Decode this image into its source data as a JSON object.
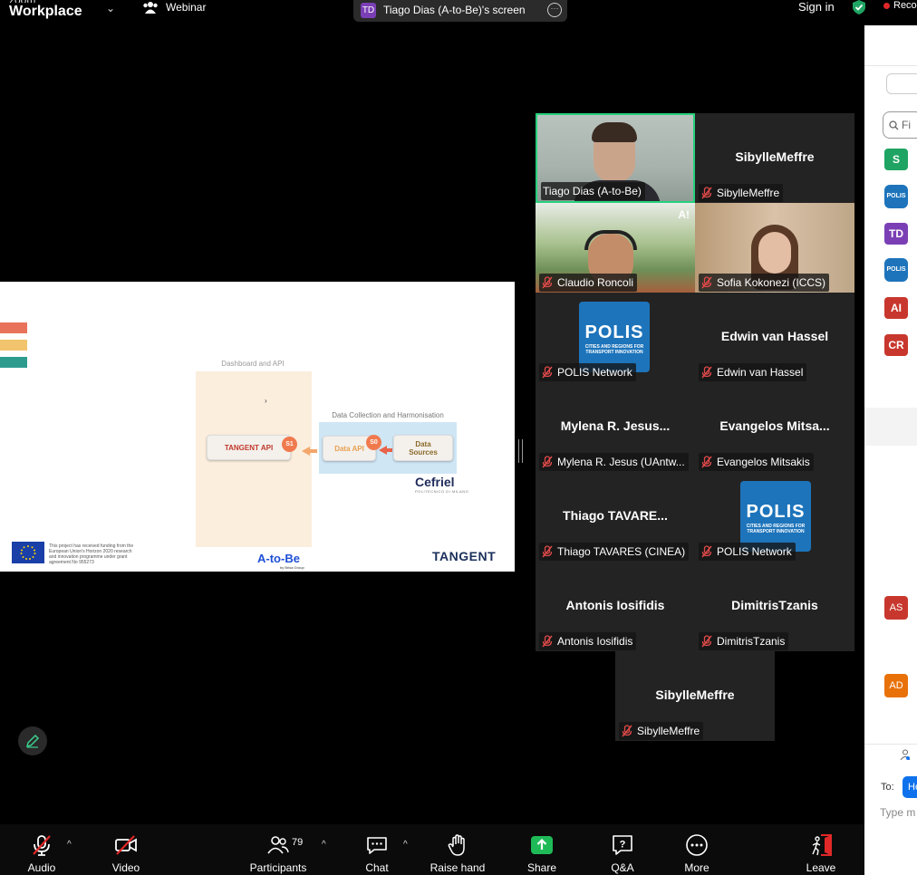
{
  "topbar": {
    "brand_top": "zoom",
    "brand_name": "Workplace",
    "webinar_label": "Webinar",
    "share_badge": "TD",
    "share_title": "Tiago Dias (A-to-Be)'s screen",
    "sign_in": "Sign in",
    "recording": "Reco"
  },
  "slide": {
    "dashboard_title": "Dashboard and API",
    "collection_title": "Data Collection and Harmonisation",
    "tangent_api": "TANGENT API",
    "data_api": "Data API",
    "data_sources": "Data Sources",
    "step_s1": "S1",
    "step_s0": "S0",
    "cefriel": "Cefriel",
    "cefriel_sub": "POLITECNICO DI MILANO",
    "eu_text": "This project has received funding from the European Union's Horizon 2020 research and innovation programme under grant agreement No 955273",
    "atobe": "A-to-Be",
    "atobe_sub": "by Brisa Group",
    "tangent": "TANGENT",
    "colors": {
      "bar1": "#e8735a",
      "bar2": "#f2c46d",
      "bar3": "#2e9b8f"
    }
  },
  "gallery": [
    {
      "display_name": "",
      "label": "Tiago Dias (A-to-Be)",
      "muted": false,
      "video": true
    },
    {
      "display_name": "SibylleMeffre",
      "label": "SibylleMeffre",
      "muted": true
    },
    {
      "display_name": "",
      "label": "Claudio Roncoli",
      "muted": true,
      "video": true,
      "flag": "A!"
    },
    {
      "display_name": "",
      "label": "Sofia Kokonezi (ICCS)",
      "muted": true,
      "video": true
    },
    {
      "display_name": "",
      "label": "POLIS Network",
      "muted": true,
      "polis": true
    },
    {
      "display_name": "Edwin van Hassel",
      "label": "Edwin van Hassel",
      "muted": true
    },
    {
      "display_name": "Mylena R. Jesus...",
      "label": "Mylena R. Jesus (UAntw...",
      "muted": true
    },
    {
      "display_name": "Evangelos  Mitsa...",
      "label": "Evangelos Mitsakis",
      "muted": true
    },
    {
      "display_name": "Thiago  TAVARE...",
      "label": "Thiago TAVARES (CINEA)",
      "muted": true
    },
    {
      "display_name": "",
      "label": "POLIS Network",
      "muted": true,
      "polis": true
    },
    {
      "display_name": "Antonis Iosifidis",
      "label": "Antonis Iosifidis",
      "muted": true
    },
    {
      "display_name": "DimitrisTzanis",
      "label": "DimitrisTzanis",
      "muted": true
    },
    {
      "display_name": "SibylleMeffre",
      "label": "SibylleMeffre",
      "muted": true
    }
  ],
  "polis_logo": {
    "title": "POLIS",
    "subtitle": "CITIES AND REGIONS FOR TRANSPORT INNOVATION"
  },
  "right_panel": {
    "search_placeholder": "Fi",
    "avatars": [
      {
        "initials": "S",
        "color": "#1fa463"
      },
      {
        "initials": "POLIS",
        "color": "#1d74bb"
      },
      {
        "initials": "TD",
        "color": "#7b3fb5"
      },
      {
        "initials": "POLIS",
        "color": "#1d74bb"
      },
      {
        "initials": "AI",
        "color": "#c8372d"
      },
      {
        "initials": "CR",
        "color": "#c8372d"
      },
      {
        "initials": "AS",
        "color": "#c8372d"
      },
      {
        "initials": "AD",
        "color": "#e8710a"
      }
    ],
    "to_label": "To:",
    "to_value": "He",
    "type_placeholder": "Type m"
  },
  "toolbar": {
    "audio": "Audio",
    "video": "Video",
    "participants": "Participants",
    "participants_count": "79",
    "chat": "Chat",
    "raise_hand": "Raise hand",
    "share": "Share",
    "qa": "Q&A",
    "more": "More",
    "leave": "Leave"
  }
}
